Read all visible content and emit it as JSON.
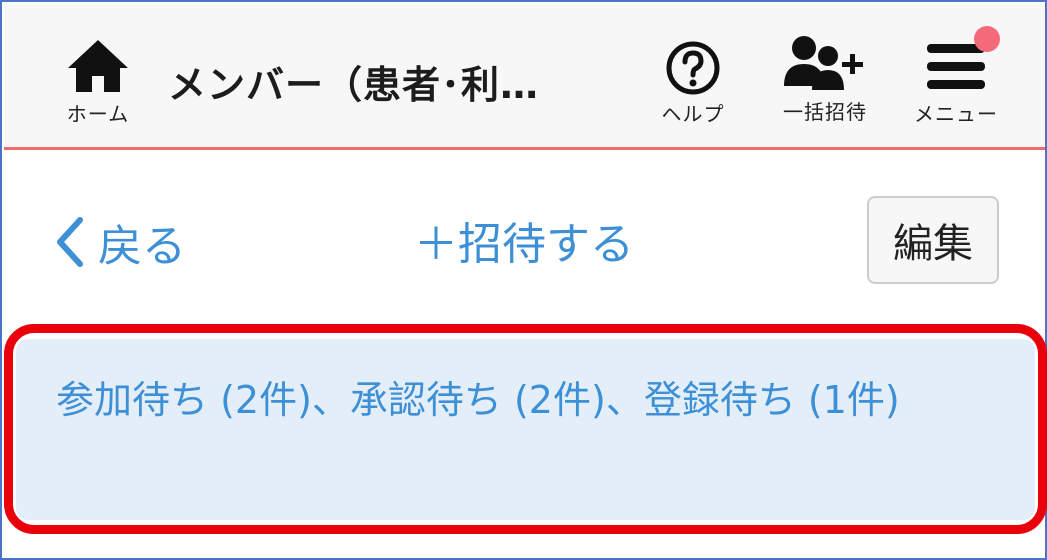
{
  "header": {
    "home_label": "ホーム",
    "title": "メンバー（患者･利…",
    "help_label": "ヘルプ",
    "bulk_invite_label": "一括招待",
    "menu_label": "メニュー"
  },
  "toolbar": {
    "back_label": "戻る",
    "invite_label": "＋招待する",
    "edit_label": "編集"
  },
  "notice": {
    "text": "参加待ち (2件)、承認待ち (2件)、登録待ち (1件)"
  },
  "colors": {
    "accent": "#3d8fd6",
    "header_border": "#f26b6b",
    "highlight": "#e8000b",
    "notice_bg": "#e3eef8",
    "notification": "#f46a7a"
  },
  "icons": {
    "home": "home-icon",
    "help": "help-circle-icon",
    "bulk_invite": "add-users-icon",
    "menu": "hamburger-menu-icon",
    "back": "chevron-left-icon"
  }
}
